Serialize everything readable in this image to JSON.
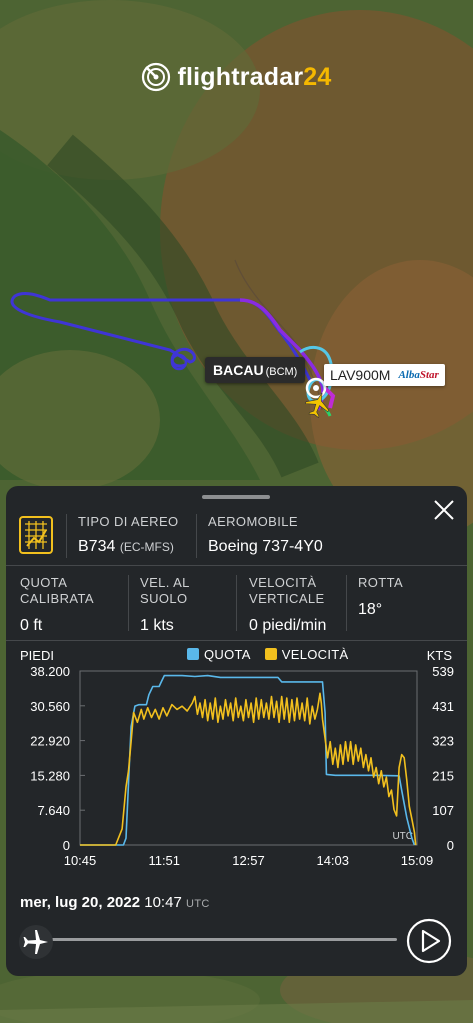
{
  "brand": {
    "name_main": "flightradar",
    "name_num": "24"
  },
  "map": {
    "airport_label": "BACAU",
    "airport_code": "(BCM)",
    "flight_callsign": "LAV900M",
    "airline_logo_a": "Alba",
    "airline_logo_b": "Star"
  },
  "panel": {
    "aircraft_type_label": "TIPO DI AEREO",
    "aircraft_type_value": "B734",
    "aircraft_reg": "(EC-MFS)",
    "aircraft_label": "AEROMOBILE",
    "aircraft_value": "Boeing 737-4Y0",
    "stats": [
      {
        "label1": "QUOTA",
        "label2": "CALIBRATA",
        "value": "0 ft"
      },
      {
        "label1": "VEL. AL",
        "label2": "SUOLO",
        "value": "1 kts"
      },
      {
        "label1": "VELOCITÀ",
        "label2": "VERTICALE",
        "value": "0 piedi/min"
      },
      {
        "label1": "ROTTA",
        "label2": "",
        "value": "18°"
      }
    ],
    "date": "mer, lug 20, 2022",
    "time": "10:47",
    "time_zone": "UTC"
  },
  "chart_data": {
    "type": "line",
    "left_axis_label": "PIEDI",
    "right_axis_label": "KTS",
    "corner_label": "UTC",
    "legend": [
      {
        "name": "QUOTA",
        "color": "#5ab8ea"
      },
      {
        "name": "VELOCITÀ",
        "color": "#f2c01e"
      }
    ],
    "y_left_ticks": [
      "38.200",
      "30.560",
      "22.920",
      "15.280",
      "7.640",
      "0"
    ],
    "y_right_ticks": [
      "539",
      "431",
      "323",
      "215",
      "107",
      "0"
    ],
    "x_ticks": [
      "10:45",
      "11:51",
      "12:57",
      "14:03",
      "15:09"
    ],
    "ylim_left": [
      0,
      38200
    ],
    "ylim_right": [
      0,
      539
    ],
    "xlim_minutes": [
      0,
      264
    ],
    "series": [
      {
        "name": "QUOTA",
        "color": "#5ab8ea",
        "points": [
          [
            0,
            0
          ],
          [
            28,
            0
          ],
          [
            34,
            0
          ],
          [
            36,
            1500
          ],
          [
            40,
            26000
          ],
          [
            43,
            30500
          ],
          [
            46,
            30800
          ],
          [
            52,
            30800
          ],
          [
            54,
            33000
          ],
          [
            57,
            34800
          ],
          [
            62,
            34800
          ],
          [
            64,
            36000
          ],
          [
            66,
            37200
          ],
          [
            80,
            37200
          ],
          [
            90,
            37000
          ],
          [
            100,
            37200
          ],
          [
            110,
            36800
          ],
          [
            155,
            36800
          ],
          [
            158,
            35800
          ],
          [
            175,
            35800
          ],
          [
            190,
            35800
          ],
          [
            192,
            29000
          ],
          [
            193,
            15500
          ],
          [
            200,
            15300
          ],
          [
            230,
            15300
          ],
          [
            250,
            15200
          ],
          [
            252,
            12000
          ],
          [
            256,
            6000
          ],
          [
            260,
            1500
          ],
          [
            262,
            0
          ]
        ]
      },
      {
        "name": "VELOCITÀ",
        "color": "#f2c01e",
        "points": [
          [
            0,
            0
          ],
          [
            28,
            0
          ],
          [
            33,
            50
          ],
          [
            36,
            180
          ],
          [
            38,
            230
          ],
          [
            40,
            320
          ],
          [
            42,
            410
          ],
          [
            45,
            380
          ],
          [
            48,
            420
          ],
          [
            50,
            390
          ],
          [
            53,
            425
          ],
          [
            56,
            395
          ],
          [
            59,
            420
          ],
          [
            62,
            390
          ],
          [
            65,
            425
          ],
          [
            68,
            400
          ],
          [
            72,
            435
          ],
          [
            76,
            420
          ],
          [
            80,
            430
          ],
          [
            84,
            415
          ],
          [
            88,
            440
          ],
          [
            90,
            460
          ],
          [
            92,
            405
          ],
          [
            94,
            440
          ],
          [
            96,
            395
          ],
          [
            98,
            450
          ],
          [
            100,
            385
          ],
          [
            102,
            440
          ],
          [
            104,
            390
          ],
          [
            106,
            455
          ],
          [
            108,
            380
          ],
          [
            110,
            430
          ],
          [
            112,
            390
          ],
          [
            114,
            450
          ],
          [
            116,
            400
          ],
          [
            118,
            440
          ],
          [
            120,
            385
          ],
          [
            122,
            455
          ],
          [
            124,
            395
          ],
          [
            126,
            430
          ],
          [
            128,
            385
          ],
          [
            130,
            450
          ],
          [
            132,
            395
          ],
          [
            134,
            440
          ],
          [
            136,
            380
          ],
          [
            138,
            455
          ],
          [
            140,
            390
          ],
          [
            142,
            450
          ],
          [
            144,
            395
          ],
          [
            146,
            440
          ],
          [
            148,
            390
          ],
          [
            150,
            460
          ],
          [
            152,
            395
          ],
          [
            154,
            445
          ],
          [
            156,
            380
          ],
          [
            158,
            460
          ],
          [
            160,
            390
          ],
          [
            162,
            455
          ],
          [
            164,
            380
          ],
          [
            166,
            450
          ],
          [
            168,
            385
          ],
          [
            170,
            455
          ],
          [
            172,
            390
          ],
          [
            174,
            440
          ],
          [
            176,
            385
          ],
          [
            178,
            455
          ],
          [
            180,
            375
          ],
          [
            182,
            430
          ],
          [
            184,
            390
          ],
          [
            186,
            420
          ],
          [
            188,
            470
          ],
          [
            189,
            440
          ],
          [
            190,
            390
          ],
          [
            192,
            330
          ],
          [
            194,
            270
          ],
          [
            196,
            320
          ],
          [
            198,
            250
          ],
          [
            200,
            300
          ],
          [
            202,
            240
          ],
          [
            204,
            310
          ],
          [
            206,
            250
          ],
          [
            208,
            320
          ],
          [
            210,
            260
          ],
          [
            212,
            320
          ],
          [
            214,
            250
          ],
          [
            216,
            310
          ],
          [
            218,
            260
          ],
          [
            220,
            300
          ],
          [
            222,
            240
          ],
          [
            224,
            280
          ],
          [
            226,
            230
          ],
          [
            228,
            270
          ],
          [
            230,
            210
          ],
          [
            232,
            240
          ],
          [
            234,
            190
          ],
          [
            236,
            230
          ],
          [
            238,
            180
          ],
          [
            240,
            210
          ],
          [
            242,
            150
          ],
          [
            244,
            170
          ],
          [
            246,
            110
          ],
          [
            248,
            90
          ],
          [
            250,
            240
          ],
          [
            252,
            280
          ],
          [
            254,
            270
          ],
          [
            256,
            200
          ],
          [
            258,
            120
          ],
          [
            260,
            80
          ],
          [
            262,
            40
          ],
          [
            263,
            0
          ]
        ]
      }
    ]
  }
}
